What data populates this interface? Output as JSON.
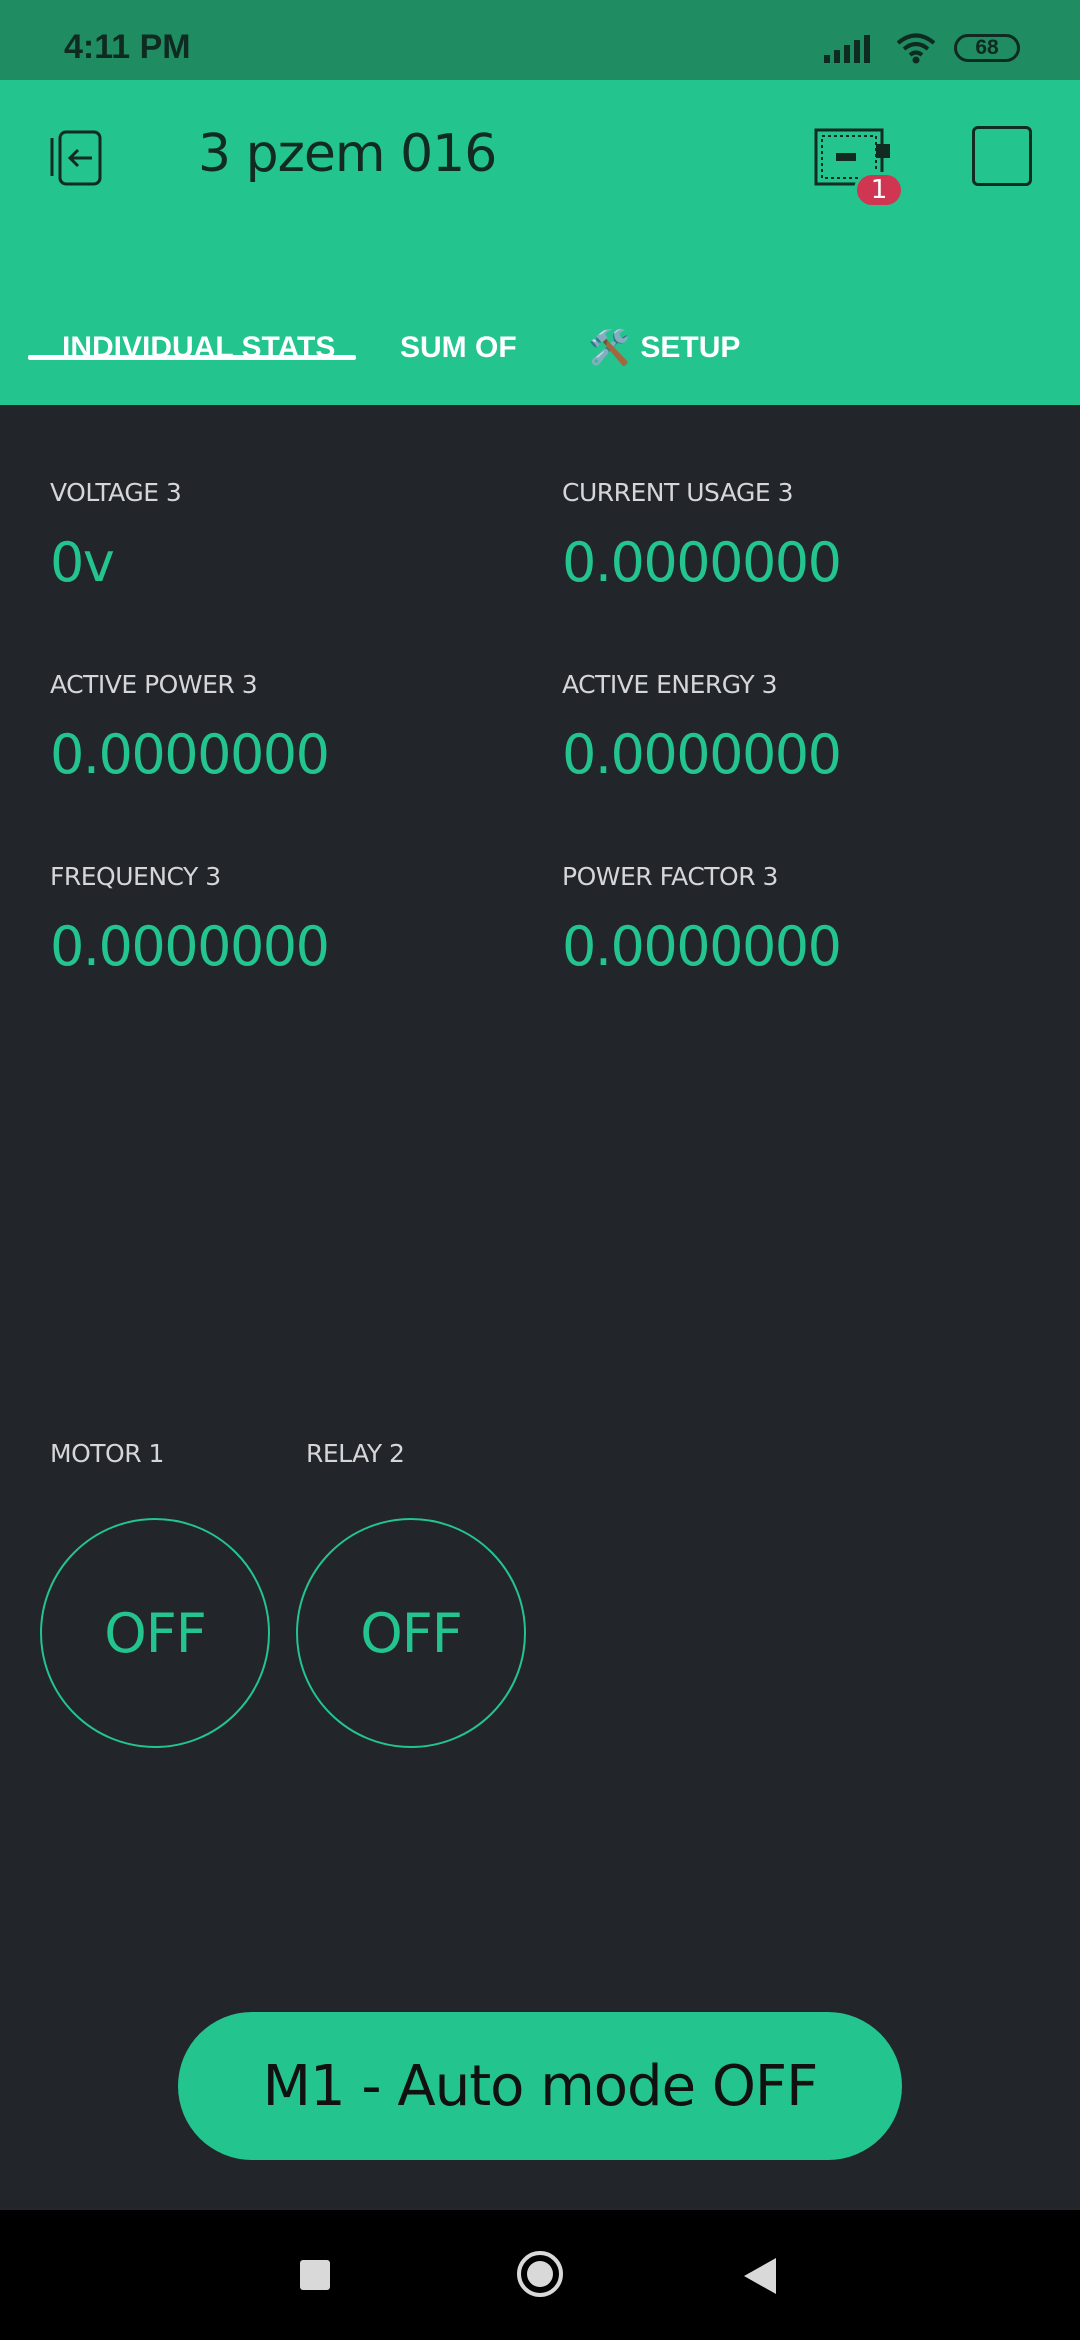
{
  "status_bar": {
    "time": "4:11 PM",
    "battery": "68"
  },
  "app_bar": {
    "title": "3 pzem 016",
    "notification_count": "1",
    "icons": [
      "back-icon",
      "device-icon",
      "square-icon"
    ]
  },
  "tabs": [
    {
      "label": "INDIVIDUAL STATS",
      "selected": true
    },
    {
      "label": "SUM OF",
      "selected": false
    },
    {
      "label": "SETUP",
      "icon": "🛠️",
      "selected": false
    }
  ],
  "metrics": [
    {
      "label": "VOLTAGE 3",
      "value": "0v"
    },
    {
      "label": "CURRENT USAGE 3",
      "value": "0.0000000"
    },
    {
      "label": "ACTIVE POWER 3",
      "value": "0.0000000"
    },
    {
      "label": "ACTIVE ENERGY 3",
      "value": "0.0000000"
    },
    {
      "label": "FREQUENCY 3",
      "value": "0.0000000"
    },
    {
      "label": "POWER FACTOR 3",
      "value": "0.0000000"
    }
  ],
  "buttons": [
    {
      "label": "MOTOR 1",
      "state": "OFF"
    },
    {
      "label": "RELAY 2",
      "state": "OFF"
    }
  ],
  "auto_mode_button": {
    "label": "M1 - Auto mode OFF"
  },
  "colors": {
    "accent": "#23c48e",
    "background": "#22252a",
    "badge": "#d03652"
  }
}
